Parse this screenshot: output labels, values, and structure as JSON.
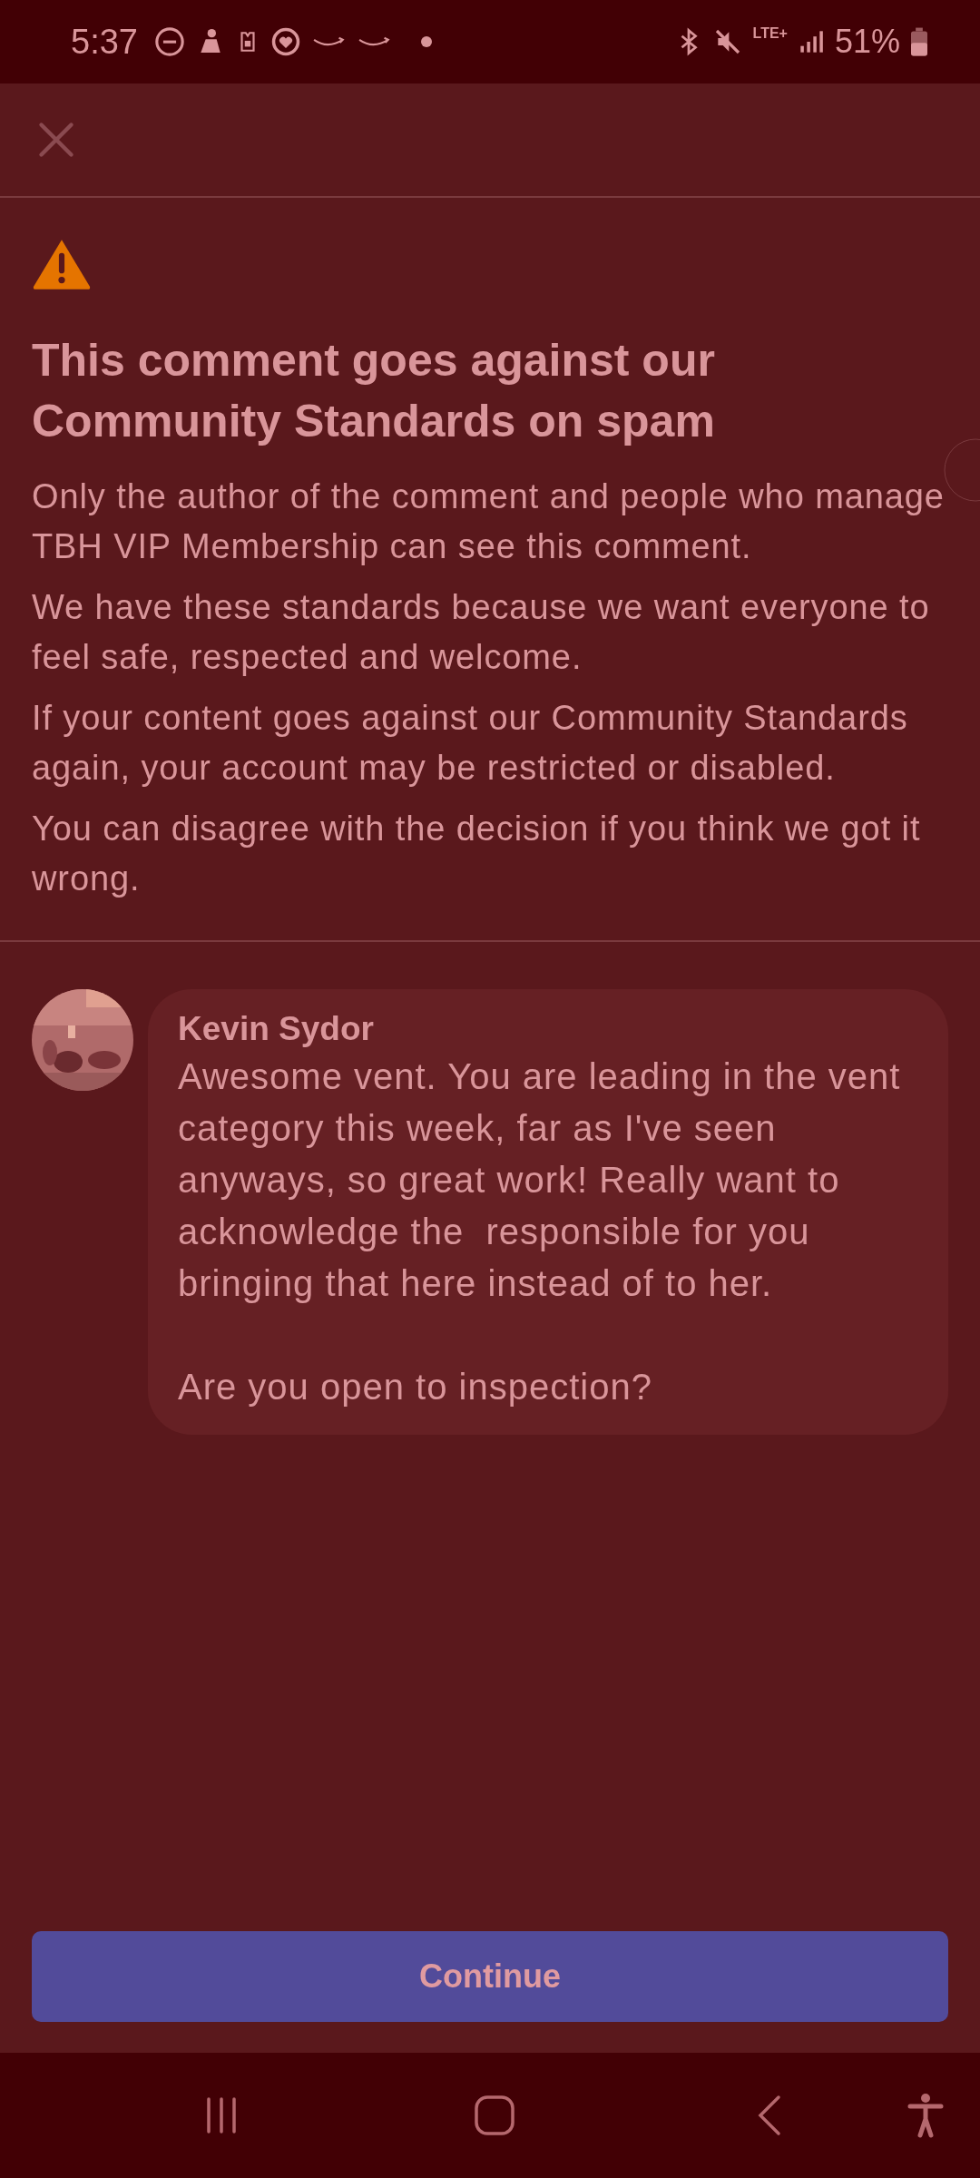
{
  "status_bar": {
    "time": "5:37",
    "network": "LTE+",
    "battery": "51%"
  },
  "notice": {
    "title": "This comment goes against our Community Standards on spam",
    "paragraphs": [
      "Only the author of the comment and people who manage TBH VIP Membership can see this comment.",
      "We have these standards because we want everyone to feel safe, respected and welcome.",
      "If your content goes against our Community Standards again, your account may be restricted or disabled.",
      "You can disagree with the decision if you think we got it wrong."
    ]
  },
  "comment": {
    "author": "Kevin Sydor",
    "text": "Awesome vent. You are leading in the vent category this week, far as I've seen anyways, so great work! Really want to acknowledge the  responsible for you bringing that here instead of to her.\n\nAre you open to inspection?"
  },
  "button": "Continue"
}
